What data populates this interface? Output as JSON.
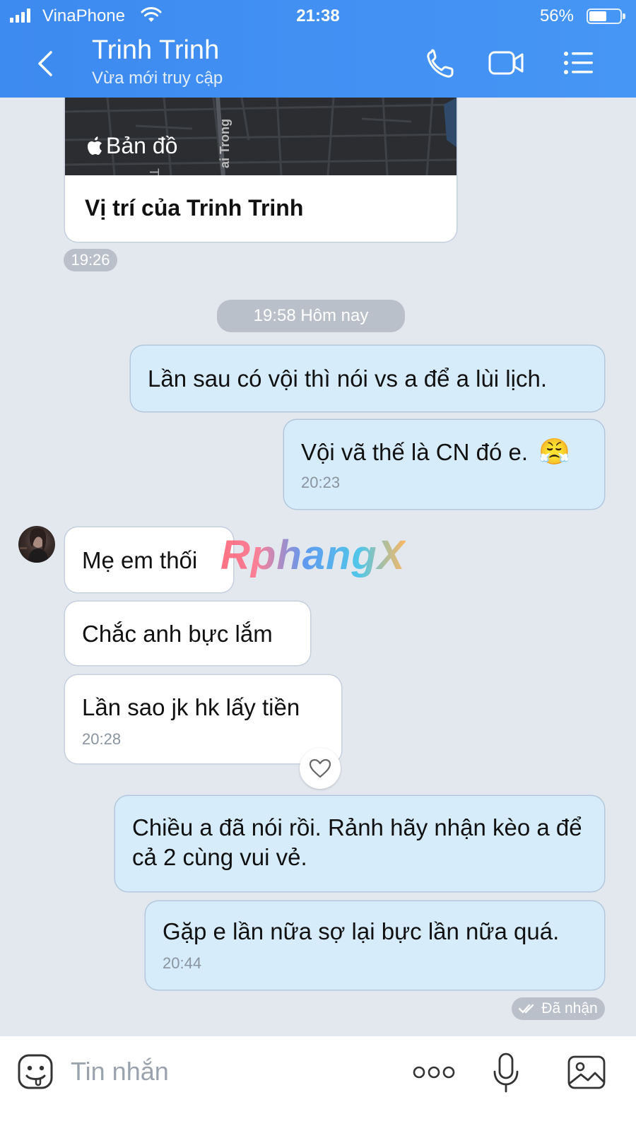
{
  "status_bar": {
    "carrier": "VinaPhone",
    "time": "21:38",
    "battery": "56%"
  },
  "header": {
    "name": "Trinh Trinh",
    "status": "Vừa mới truy cập",
    "icons": [
      "back-arrow-icon",
      "phone-icon",
      "video-camera-icon",
      "menu-list-icon"
    ],
    "accent_color": "#3d8af0"
  },
  "map_card": {
    "map_label": "Bản đồ",
    "street_labels": [
      "Tê",
      "ai Trong"
    ],
    "title": "Vị trí của Trinh Trinh",
    "time": "19:26"
  },
  "date_separator": "19:58 Hôm nay",
  "messages": [
    {
      "side": "out",
      "text": "Lần sau có vội thì nói vs a để a lùi lịch."
    },
    {
      "side": "out",
      "text": "Vội vã thế là CN đó e.",
      "emoji": "😤",
      "time": "20:23"
    },
    {
      "side": "in",
      "text": "Mẹ em thối"
    },
    {
      "side": "in",
      "text": "Chắc anh bực lắm"
    },
    {
      "side": "in",
      "text": "Lần sao jk hk lấy tiền",
      "time": "20:28"
    },
    {
      "side": "out",
      "text": "Chiều a đã nói rồi. Rảnh hãy nhận kèo a để cả 2 cùng vui vẻ."
    },
    {
      "side": "out",
      "text": "Gặp e lần nữa sợ lại bực lần nữa quá.",
      "time": "20:44"
    }
  ],
  "watermark": "RphangX",
  "receipt": "Đã nhận",
  "input": {
    "placeholder": "Tin nhắn"
  },
  "colors": {
    "outgoing_bubble": "#d6ecfb",
    "incoming_bubble": "#ffffff",
    "chat_background": "#e3e8ef"
  }
}
